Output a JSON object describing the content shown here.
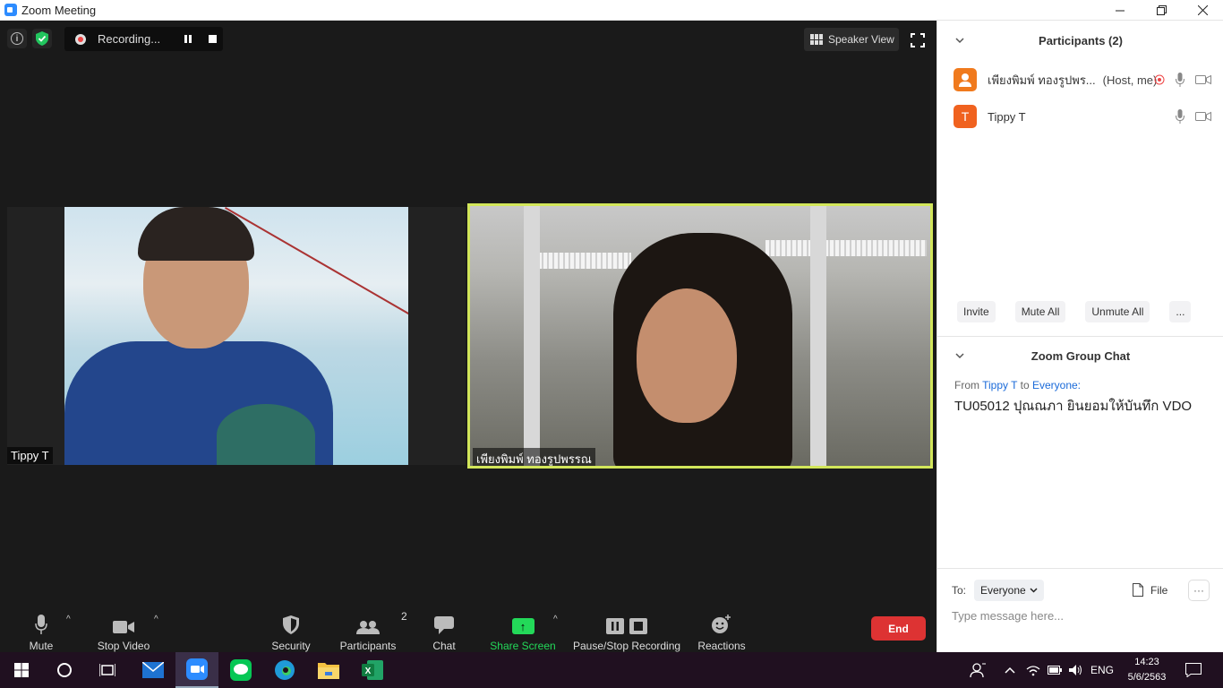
{
  "window": {
    "title": "Zoom Meeting"
  },
  "meeting": {
    "recording_label": "Recording...",
    "speaker_view_label": "Speaker View",
    "participant_1_name": "Tippy T",
    "participant_2_name": "เพียงพิมพ์ ทองรูปพรรณ"
  },
  "toolbar": {
    "mute": "Mute",
    "stop_video": "Stop Video",
    "security": "Security",
    "participants": "Participants",
    "participants_count": "2",
    "chat": "Chat",
    "share_screen": "Share Screen",
    "pause_stop_recording": "Pause/Stop Recording",
    "reactions": "Reactions",
    "end": "End"
  },
  "panel": {
    "participants_title": "Participants (2)",
    "participants": [
      {
        "name": "เพียงพิมพ์ ทองรูปพร...",
        "role": "(Host, me)",
        "avatar_color": "#f07a1d"
      },
      {
        "name": "Tippy T",
        "role": "",
        "avatar_letter": "T",
        "avatar_color": "#f0621f"
      }
    ],
    "buttons": {
      "invite": "Invite",
      "mute_all": "Mute All",
      "unmute_all": "Unmute All",
      "more": "..."
    },
    "chat_title": "Zoom Group Chat",
    "chat": {
      "from_prefix": "From",
      "from_name": "Tippy T",
      "to_word": "to",
      "to_name": "Everyone:",
      "message": "TU05012 ปุณณภา ยินยอมให้บันทึก VDO"
    },
    "compose": {
      "to_label": "To:",
      "to_value": "Everyone",
      "file_label": "File",
      "more_label": "···",
      "placeholder": "Type message here..."
    }
  },
  "taskbar": {
    "language": "ENG",
    "time": "14:23",
    "date": "5/6/2563"
  },
  "colors": {
    "accent": "#2d8cff",
    "end": "#dd3333",
    "share": "#23d959",
    "active_speaker_border": "#d2e65a"
  }
}
